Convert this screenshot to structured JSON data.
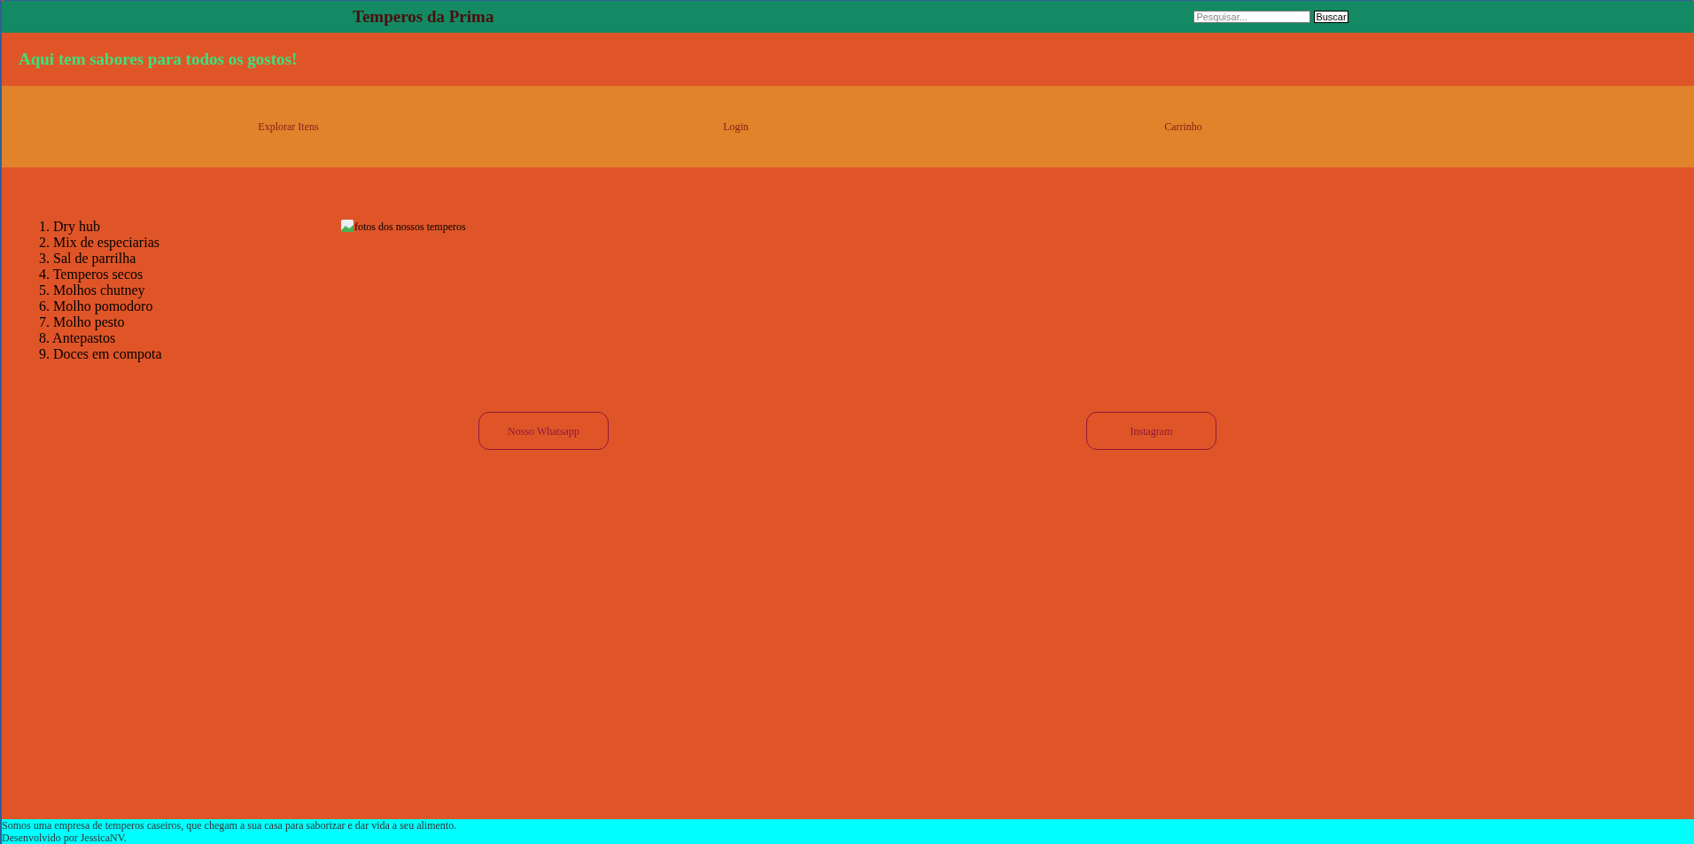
{
  "header": {
    "title": "Temperos da Prima",
    "search": {
      "placeholder": "Pesquisar...",
      "button": "Buscar"
    }
  },
  "tagline": "Aqui tem sabores para todos os gostos!",
  "nav": [
    "Explorar Itens",
    "Login",
    "Carrinho"
  ],
  "products": [
    {
      "number": "1.",
      "name": "Dry hub"
    },
    {
      "number": "2.",
      "name": "Mix de especiarias"
    },
    {
      "number": "3.",
      "name": "Sal de parrilha"
    },
    {
      "number": "4.",
      "name": "Temperos secos"
    },
    {
      "number": "5.",
      "name": "Molhos chutney"
    },
    {
      "number": "6.",
      "name": "Molho pomodoro"
    },
    {
      "number": "7.",
      "name": "Molho pesto"
    },
    {
      "number": "8.",
      "name": "Antepastos"
    },
    {
      "number": "9.",
      "name": "Doces em compota"
    }
  ],
  "image": {
    "alt": "fotos dos nossos temperos"
  },
  "social_buttons": [
    "Nosso Whatsapp",
    "Instagram"
  ],
  "footer": {
    "description": "Somos uma empresa de temperos caseiros, que chegam a sua casa para saborizar e dar vida a seu alimento.",
    "credit": "Desenvolvido por JessicaNV."
  }
}
